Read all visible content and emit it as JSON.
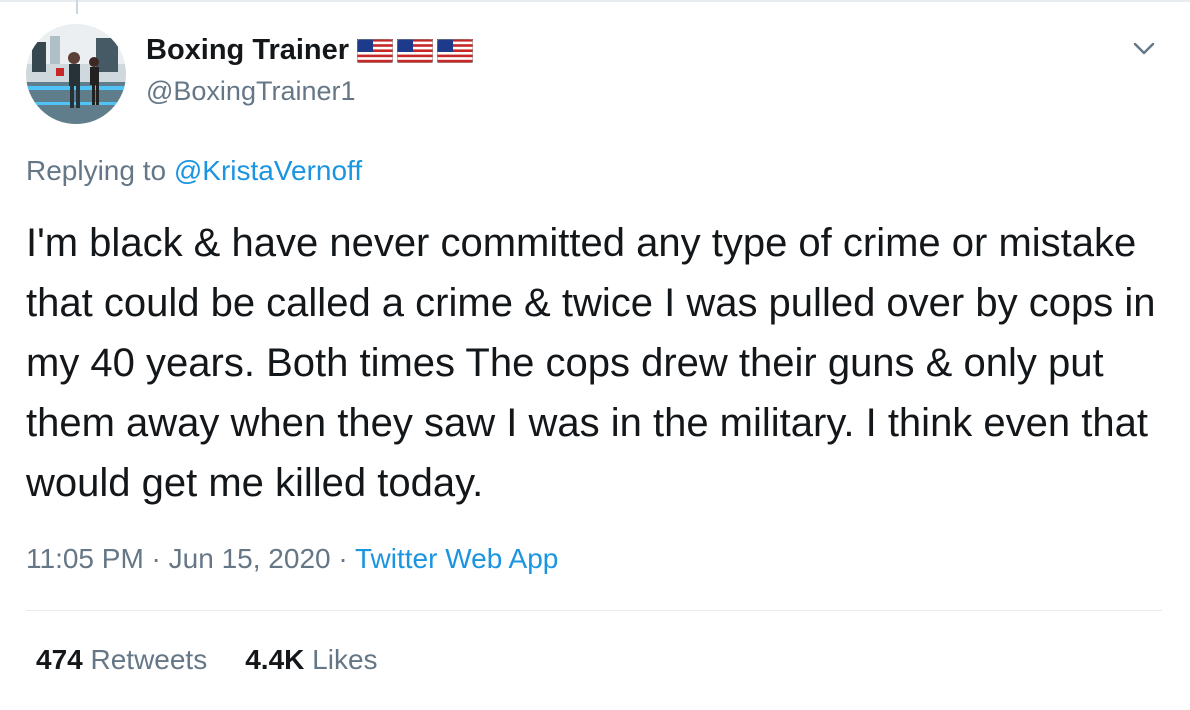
{
  "author": {
    "display_name": "Boxing Trainer",
    "flags": [
      "us-flag",
      "us-flag",
      "us-flag"
    ],
    "handle": "@BoxingTrainer1"
  },
  "reply": {
    "prefix": "Replying to ",
    "mention": "@KristaVernoff"
  },
  "tweet": {
    "text": "I'm black & have never committed any type of crime or mistake that could be called a crime & twice I was pulled over by cops in my 40 years. Both times The cops drew their guns & only put them away when they saw I was in the military. I think even that would get me killed today."
  },
  "meta": {
    "time": "11:05 PM",
    "separator": " · ",
    "date": "Jun 15, 2020",
    "app": "Twitter Web App"
  },
  "stats": {
    "retweets_count": "474",
    "retweets_label": " Retweets",
    "likes_count": "4.4K",
    "likes_label": " Likes"
  },
  "icons": {
    "menu": "chevron-down-icon"
  },
  "colors": {
    "link": "#1b95e0",
    "secondary_text": "#657786",
    "primary_text": "#14171a",
    "divider": "#e6ecf0"
  }
}
